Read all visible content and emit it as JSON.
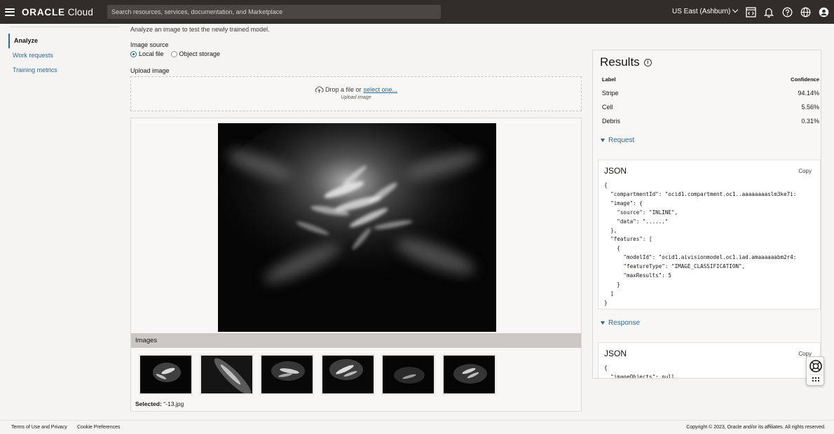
{
  "header": {
    "brand_oracle": "ORACLE",
    "brand_cloud": "Cloud",
    "search_placeholder": "Search resources, services, documentation, and Marketplace",
    "region": "US East (Ashburn)",
    "icons": [
      "menu-icon",
      "code-editor-icon",
      "bell-icon",
      "help-icon",
      "globe-icon",
      "user-icon"
    ]
  },
  "nav": {
    "items": [
      {
        "label": "Analyze",
        "active": true
      },
      {
        "label": "Work requests"
      },
      {
        "label": "Training metrics"
      }
    ]
  },
  "main": {
    "description": "Analyze an image to test the newly trained model.",
    "image_source_label": "Image source",
    "source_options": [
      "Local file",
      "Object storage"
    ],
    "selected_source": "Local file",
    "upload_label": "Upload image",
    "drop_text": "Drop a file or",
    "select_link": "select one...",
    "drop_hint": "Upload image",
    "images_label": "Images",
    "selected_label": "Selected:",
    "selected_file": "\"-13.jpg"
  },
  "results": {
    "title": "Results",
    "columns": [
      "Label",
      "Confidence"
    ],
    "rows": [
      {
        "label": "Stripe",
        "confidence": "94.14%"
      },
      {
        "label": "Cell",
        "confidence": "5.56%"
      },
      {
        "label": "Debris",
        "confidence": "0.31%"
      }
    ],
    "request_label": "Request",
    "response_label": "Response",
    "json_title": "JSON",
    "copy_label": "Copy",
    "request_json": "{\n  \"compartmentId\": \"ocid1.compartment.oc1..aaaaaaaaslm3ke7i:\n  \"image\": {\n    \"source\": \"INLINE\",\n    \"data\": \"......\"\n  },\n  \"features\": [\n    {\n      \"modelId\": \"ocid1.aivisionmodel.oc1.iad.amaaaaaabm2r4:\n      \"featureType\": \"IMAGE_CLASSIFICATION\",\n      \"maxResults\": 5\n    }\n  ]\n}",
    "response_json": "{\n  \"imageObjects\": null,"
  },
  "footer": {
    "terms": "Terms of Use and Privacy",
    "cookies": "Cookie Preferences",
    "copyright": "Copyright © 2023, Oracle and/or its affiliates. All rights reserved."
  }
}
